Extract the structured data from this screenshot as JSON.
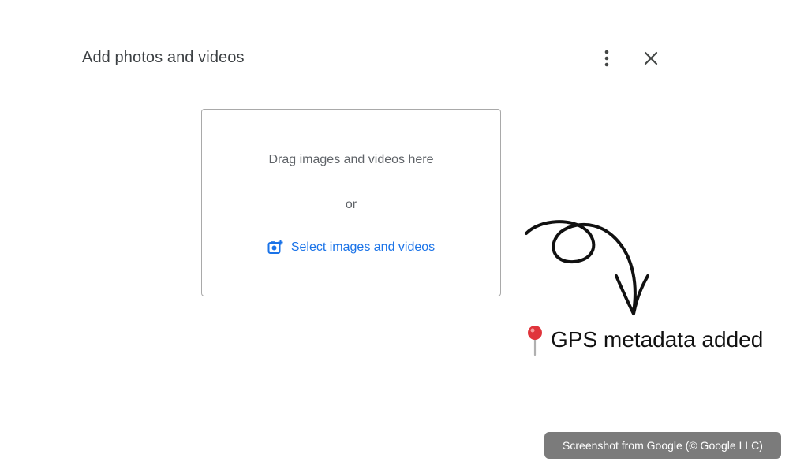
{
  "dialog": {
    "title": "Add photos and videos",
    "more_icon": "more-vert-icon",
    "close_icon": "close-icon"
  },
  "drop_zone": {
    "drag_text": "Drag images and videos here",
    "or_text": "or",
    "select_label": "Select images and videos",
    "select_icon": "add-photo-icon",
    "link_color": "#1a73e8"
  },
  "annotation": {
    "label": "GPS metadata added",
    "icon": "map-pin-icon",
    "arrow_icon": "curly-arrow-icon"
  },
  "credit": {
    "text": "Screenshot from Google (© Google LLC)"
  }
}
